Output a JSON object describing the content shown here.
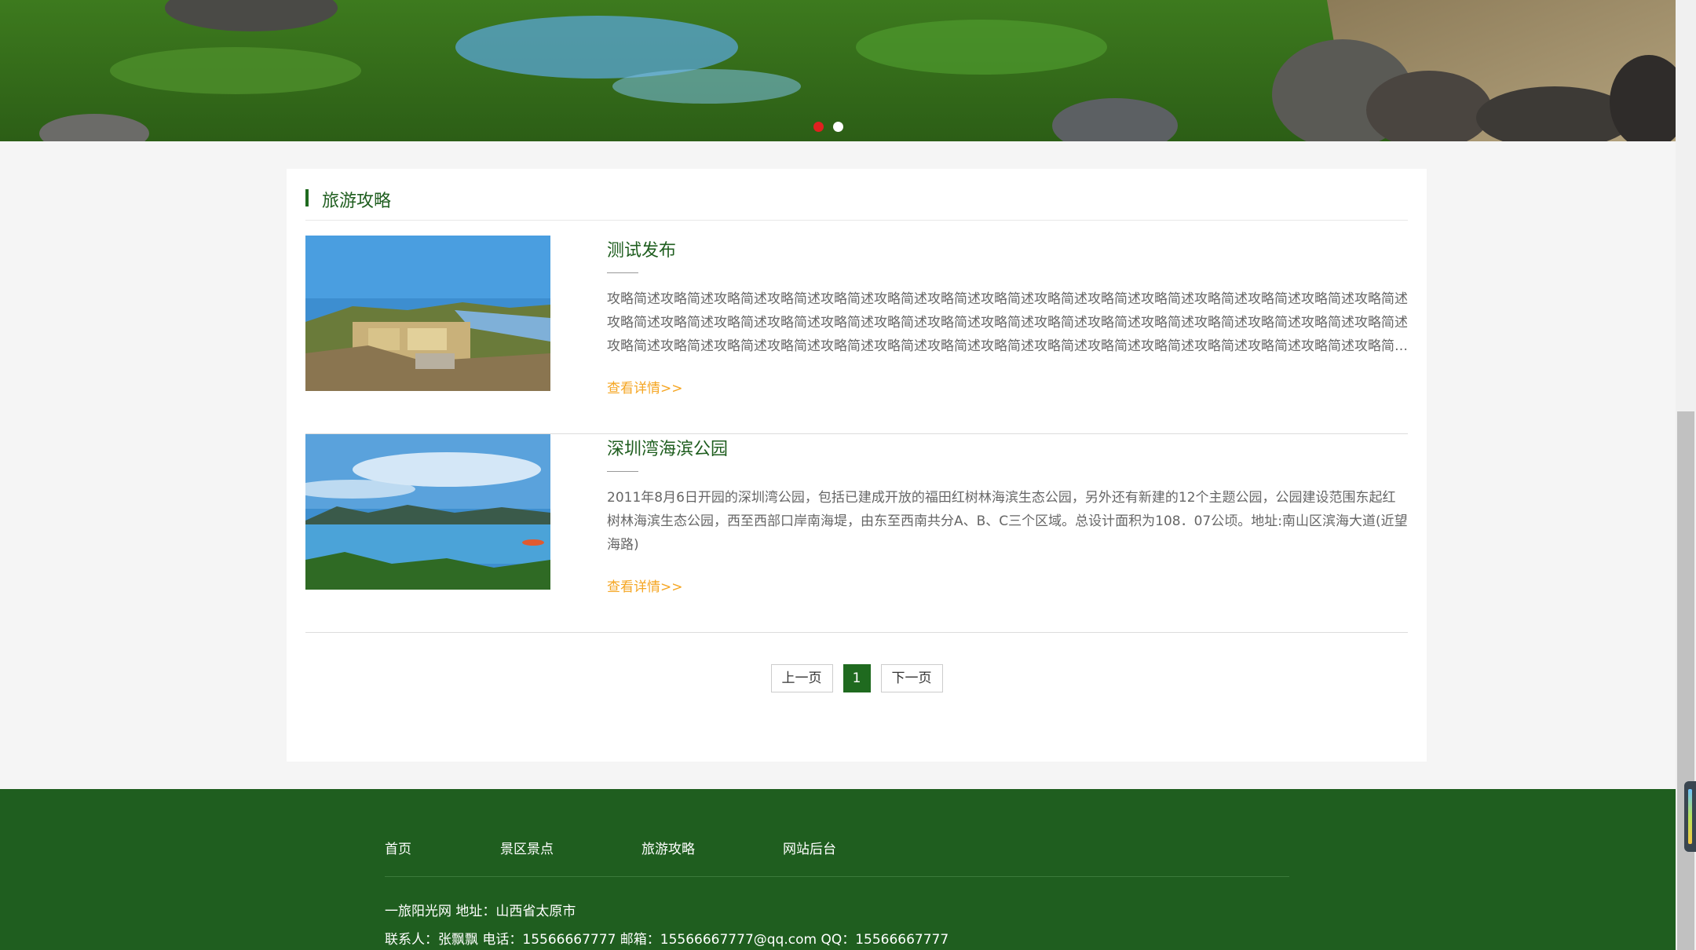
{
  "banner": {
    "slides": 2,
    "active_slide": 1
  },
  "section": {
    "title": "旅游攻略"
  },
  "articles": [
    {
      "title": "测试发布",
      "description": "攻略简述攻略简述攻略简述攻略简述攻略简述攻略简述攻略简述攻略简述攻略简述攻略简述攻略简述攻略简述攻略简述攻略简述攻略简述攻略简述攻略简述攻略简述攻略简述攻略简述攻略简述攻略简述攻略简述攻略简述攻略简述攻略简述攻略简述攻略简述攻略简述攻略简述攻略简述攻略简述攻略简述攻略简述攻略简述攻略简述攻略简述攻略简述攻略简述攻略简述攻略简述攻略简述攻略简述攻略简述攻略简述攻略简述攻略简述攻略简述攻略简述攻略...",
      "more": "查看详情>>"
    },
    {
      "title": "深圳湾海滨公园",
      "description": "2011年8月6日开园的深圳湾公园，包括已建成开放的福田红树林海滨生态公园，另外还有新建的12个主题公园，公园建设范围东起红树林海滨生态公园，西至西部口岸南海堤，由东至西南共分A、B、C三个区域。总设计面积为108．07公顷。地址:南山区滨海大道(近望海路)",
      "more": "查看详情>>"
    }
  ],
  "pagination": {
    "prev": "上一页",
    "current": "1",
    "next": "下一页"
  },
  "footer": {
    "nav": [
      "首页",
      "景区景点",
      "旅游攻略",
      "网站后台"
    ],
    "info_line1": "一旅阳光网 地址：山西省太原市",
    "info_line2": "联系人：张飘飘 电话：15566667777 邮箱：15566667777@qq.com QQ：15566667777"
  },
  "colors": {
    "brand_green": "#1f5e1f",
    "accent_orange": "#f5a623",
    "active_dot": "#e02020"
  }
}
